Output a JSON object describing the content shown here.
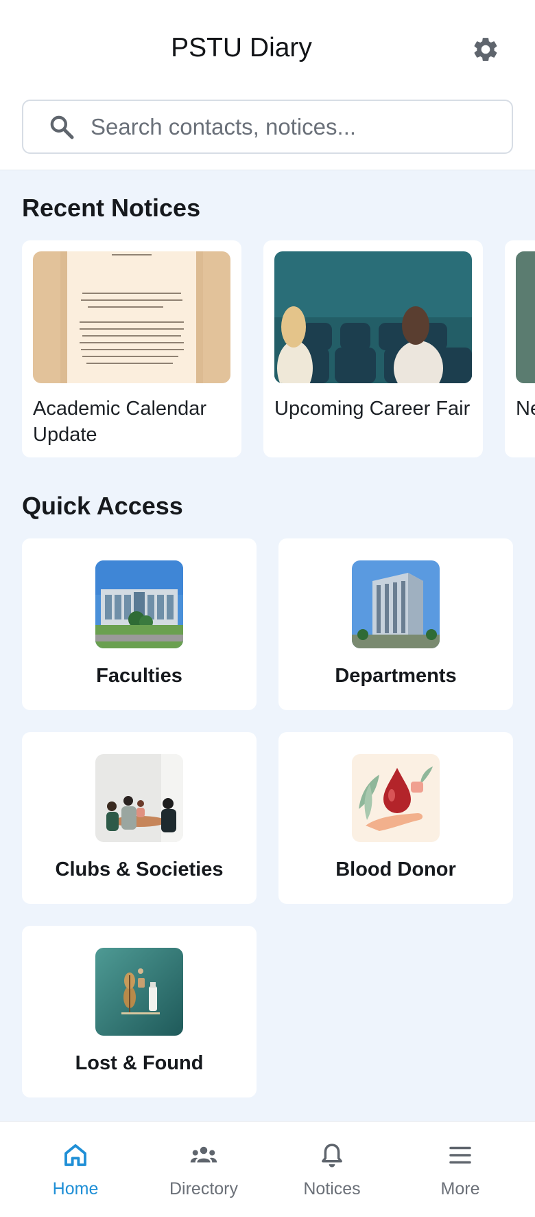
{
  "header": {
    "title": "PSTU Diary",
    "settings_icon": "gear-icon",
    "search": {
      "placeholder": "Search contacts, notices...",
      "value": "",
      "icon": "search-icon"
    }
  },
  "notices": {
    "section_title": "Recent Notices",
    "items": [
      {
        "title": "Academic Calendar Update"
      },
      {
        "title": "Upcoming Career Fair"
      },
      {
        "title": "New Announcement"
      }
    ]
  },
  "quick_access": {
    "section_title": "Quick Access",
    "items": [
      {
        "label": "Faculties"
      },
      {
        "label": "Departments"
      },
      {
        "label": "Clubs & Societies"
      },
      {
        "label": "Blood Donor"
      },
      {
        "label": "Lost & Found"
      }
    ]
  },
  "bottom_nav": {
    "items": [
      {
        "label": "Home",
        "icon": "home-icon",
        "active": true
      },
      {
        "label": "Directory",
        "icon": "people-icon",
        "active": false
      },
      {
        "label": "Notices",
        "icon": "bell-icon",
        "active": false
      },
      {
        "label": "More",
        "icon": "menu-icon",
        "active": false
      }
    ]
  },
  "colors": {
    "accent": "#1f8fd6",
    "background": "#eef4fc",
    "card": "#ffffff",
    "inactive_nav": "#6b7078"
  }
}
